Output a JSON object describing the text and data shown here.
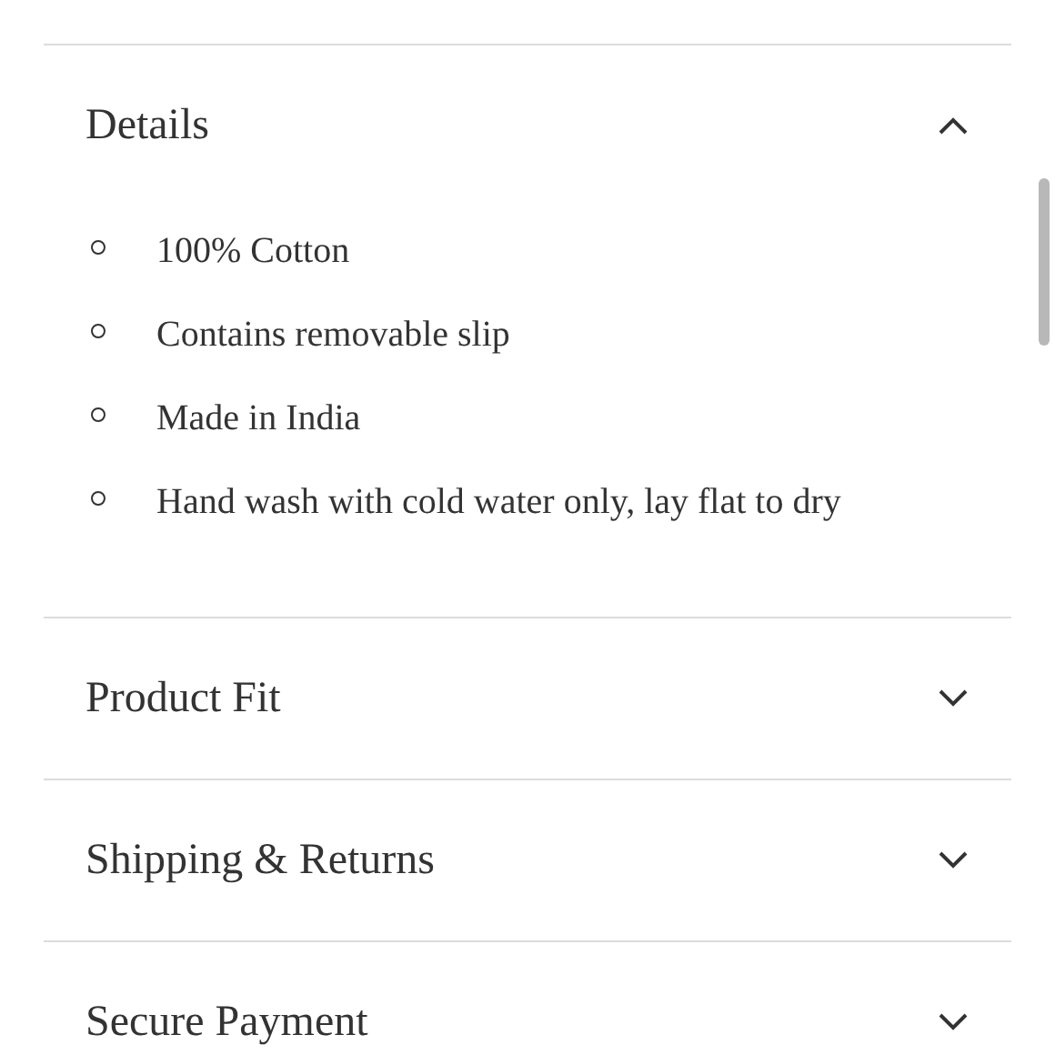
{
  "sections": [
    {
      "title": "Details",
      "expanded": true,
      "items": [
        "100% Cotton",
        "Contains removable slip",
        "Made in India",
        "Hand wash with cold water only, lay flat to dry"
      ]
    },
    {
      "title": "Product Fit",
      "expanded": false
    },
    {
      "title": "Shipping & Returns",
      "expanded": false
    },
    {
      "title": "Secure Payment",
      "expanded": false
    }
  ]
}
